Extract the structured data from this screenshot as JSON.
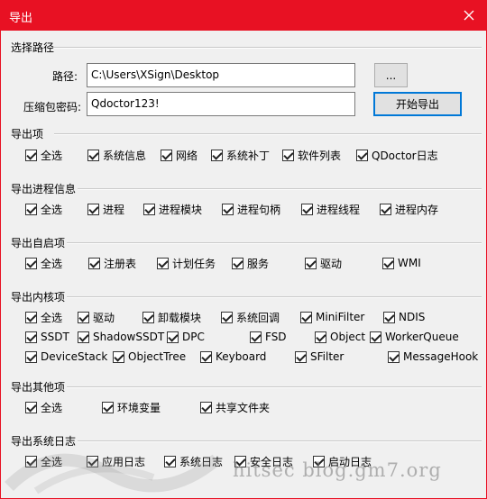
{
  "window": {
    "title": "导出",
    "close_glyph": "✕"
  },
  "path_section": {
    "title": "选择路径",
    "path_label": "路径:",
    "path_value": "C:\\Users\\XSign\\Desktop",
    "browse_label": "...",
    "password_label": "压缩包密码:",
    "password_value": "Qdoctor123!",
    "start_label": "开始导出"
  },
  "export_items": {
    "title": "导出项",
    "options": [
      "全选",
      "系统信息",
      "网络",
      "系统补丁",
      "软件列表",
      "QDoctor日志"
    ]
  },
  "process_info": {
    "title": "导出进程信息",
    "options": [
      "全选",
      "进程",
      "进程模块",
      "进程句柄",
      "进程线程",
      "进程内存"
    ]
  },
  "autostart": {
    "title": "导出自启项",
    "options": [
      "全选",
      "注册表",
      "计划任务",
      "服务",
      "驱动",
      "WMI"
    ]
  },
  "kernel": {
    "title": "导出内核项",
    "row1": [
      "全选",
      "驱动",
      "卸载模块",
      "系统回调",
      "MiniFilter",
      "NDIS"
    ],
    "row2": [
      "SSDT",
      "ShadowSSDT",
      "DPC",
      "FSD",
      "Object",
      "WorkerQueue"
    ],
    "row3": [
      "DeviceStack",
      "ObjectTree",
      "Keyboard",
      "SFilter",
      "MessageHook"
    ]
  },
  "other": {
    "title": "导出其他项",
    "options": [
      "全选",
      "环境变量",
      "共享文件夹"
    ]
  },
  "syslog": {
    "title": "导出系统日志",
    "options": [
      "全选",
      "应用日志",
      "系统日志",
      "安全日志",
      "启动日志"
    ]
  },
  "watermark": {
    "text": "hitsec blog.gm7.org"
  }
}
